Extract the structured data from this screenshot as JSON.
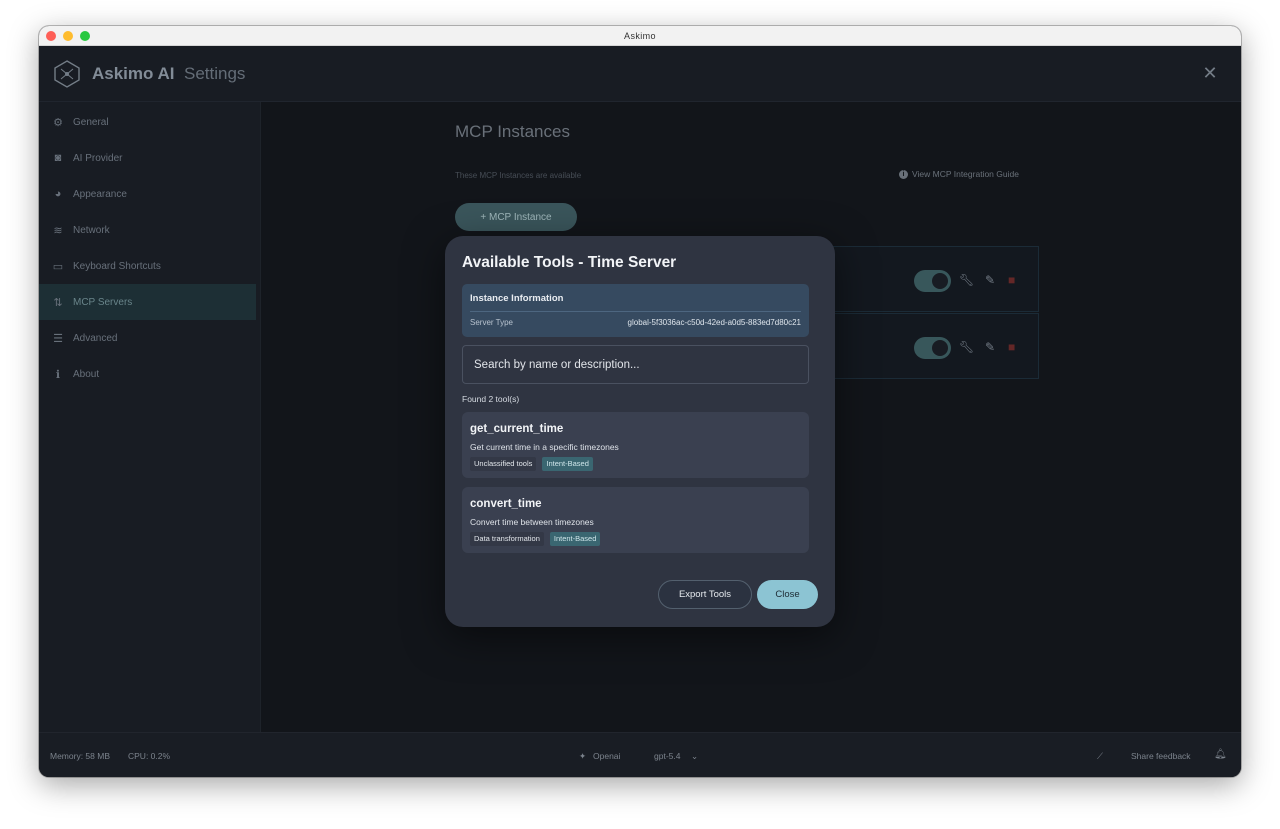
{
  "window": {
    "title": "Askimo"
  },
  "header": {
    "brand": "Askimo AI",
    "section": "Settings",
    "close_icon": "close-icon"
  },
  "sidebar": {
    "items": [
      {
        "label": "General",
        "icon": "gear-icon",
        "glyph": "⚙"
      },
      {
        "label": "AI Provider",
        "icon": "robot-icon",
        "glyph": "◙"
      },
      {
        "label": "Appearance",
        "icon": "palette-icon",
        "glyph": "◕"
      },
      {
        "label": "Network",
        "icon": "wifi-icon",
        "glyph": "≋"
      },
      {
        "label": "Keyboard Shortcuts",
        "icon": "keyboard-icon",
        "glyph": "▭"
      },
      {
        "label": "MCP Servers",
        "icon": "plug-icon",
        "glyph": "⇅"
      },
      {
        "label": "Advanced",
        "icon": "sliders-icon",
        "glyph": "☰"
      },
      {
        "label": "About",
        "icon": "info-icon",
        "glyph": "ℹ"
      }
    ],
    "active": "MCP Servers"
  },
  "main": {
    "title": "MCP Instances",
    "subtitle": "These MCP Instances are available",
    "guide_link": "View MCP Integration Guide",
    "add_button": "+ MCP Instance"
  },
  "dialog": {
    "title": "Available Tools - Time Server",
    "info_title": "Instance Information",
    "server_type_label": "Server Type",
    "server_type_value": "global-5f3036ac-c50d-42ed-a0d5-883ed7d80c21",
    "search_placeholder": "Search by name or description...",
    "found_text": "Found 2 tool(s)",
    "tools": [
      {
        "name": "get_current_time",
        "description": "Get current time in a specific timezones",
        "category": "Unclassified tools",
        "tag": "Intent-Based"
      },
      {
        "name": "convert_time",
        "description": "Convert time between timezones",
        "category": "Data transformation",
        "tag": "Intent-Based"
      }
    ],
    "export_button": "Export Tools",
    "close_button": "Close"
  },
  "statusbar": {
    "memory": "Memory: 58 MB",
    "cpu": "CPU: 0.2%",
    "provider": "Openai",
    "model": "gpt-5.4",
    "feedback": "Share feedback"
  },
  "colors": {
    "accent": "#8cc4d3",
    "intent_tag": "#3a6671",
    "active_nav": "#1f3238",
    "dialog_bg": "#2f3441"
  }
}
